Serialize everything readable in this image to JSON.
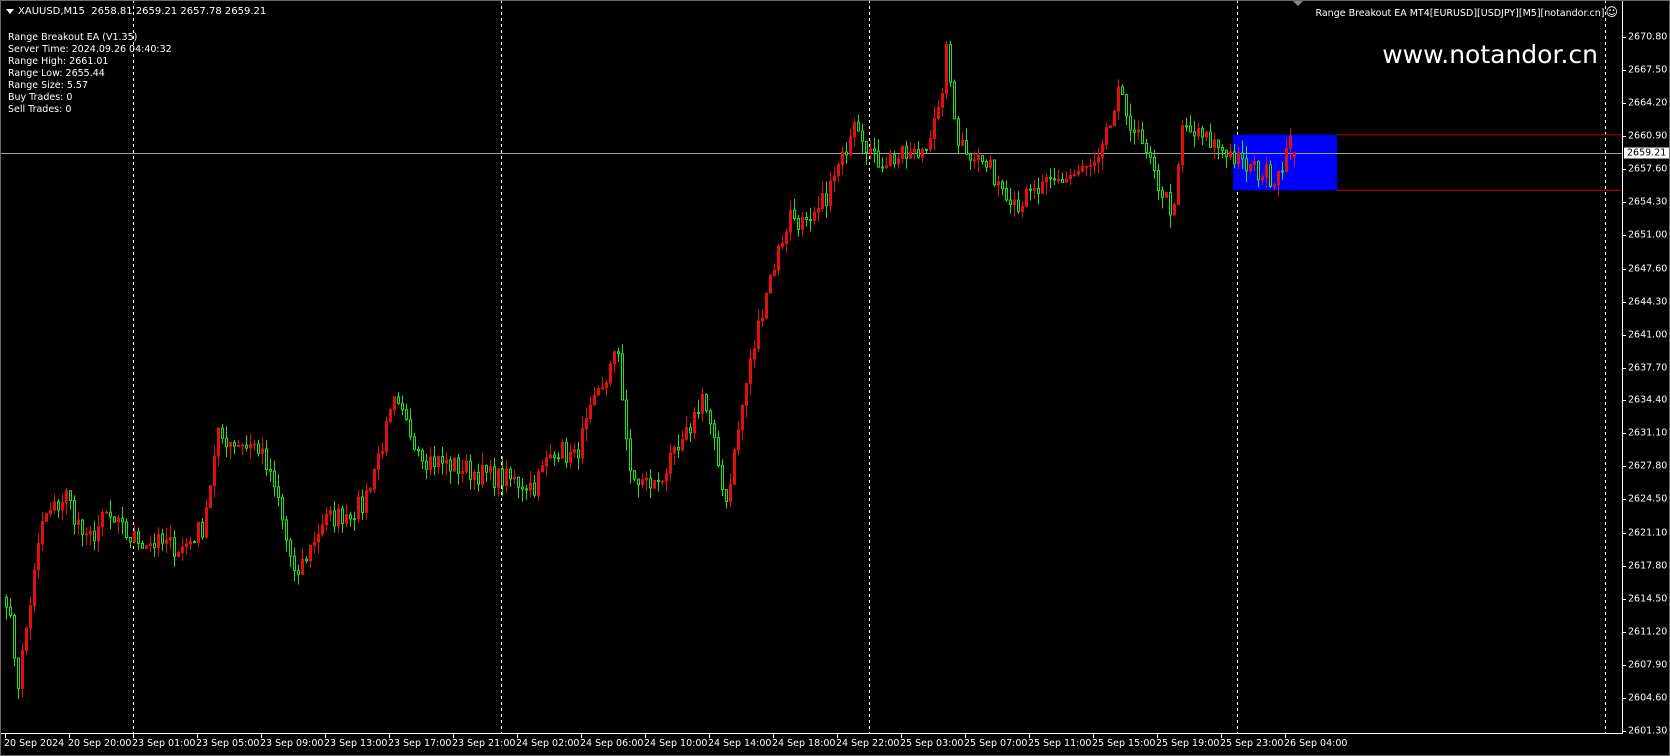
{
  "header": {
    "symbol": "XAUUSD,M15",
    "ohlc": "2658.81 2659.21 2657.78 2659.21"
  },
  "info_panel": {
    "lines": [
      "Range Breakout EA (V1.35)",
      "Server Time: 2024.09.26 04:40:32",
      "Range High: 2661.01",
      "Range Low: 2655.44",
      "Range Size: 5.57",
      "Buy Trades: 0",
      "Sell Trades: 0"
    ]
  },
  "ea_title": "Range Breakout EA MT4[EURUSD][USDJPY][M5][notandor.cn]",
  "watermark": "www.notandor.cn",
  "current_price": "2659.21",
  "colors": {
    "bull": "#e01010",
    "bear": "#20e020",
    "range_box": "#0000ff",
    "range_line": "#c00000",
    "price_line": "#a0a0a0"
  },
  "chart_data": {
    "type": "candlestick",
    "timeframe": "M15",
    "ylim": [
      2601.3,
      2670.8
    ],
    "range": {
      "high": 2661.01,
      "low": 2655.44,
      "start_bar": 307,
      "end_bar": 333
    },
    "last_bar": {
      "open": 2658.81,
      "high": 2659.21,
      "low": 2657.78,
      "close": 2659.21
    },
    "price_ticks": [
      "2670.80",
      "2667.50",
      "2664.20",
      "2660.90",
      "2657.60",
      "2654.30",
      "2651.00",
      "2647.60",
      "2644.30",
      "2641.00",
      "2637.70",
      "2634.40",
      "2631.10",
      "2627.80",
      "2624.50",
      "2621.10",
      "2617.80",
      "2614.50",
      "2611.20",
      "2607.90",
      "2604.60",
      "2601.30"
    ],
    "time_ticks": [
      "20 Sep 2024",
      "20 Sep 20:00",
      "23 Sep 01:00",
      "23 Sep 05:00",
      "23 Sep 09:00",
      "23 Sep 13:00",
      "23 Sep 17:00",
      "23 Sep 21:00",
      "24 Sep 02:00",
      "24 Sep 06:00",
      "24 Sep 10:00",
      "24 Sep 14:00",
      "24 Sep 18:00",
      "24 Sep 22:00",
      "25 Sep 03:00",
      "25 Sep 07:00",
      "25 Sep 11:00",
      "25 Sep 15:00",
      "25 Sep 19:00",
      "25 Sep 23:00",
      "26 Sep 04:00"
    ],
    "day_separator_bars": [
      32,
      124,
      216,
      308,
      400
    ],
    "close_path_bar_price": [
      [
        0,
        2614.8
      ],
      [
        3,
        2606.2
      ],
      [
        9,
        2622.2
      ],
      [
        15,
        2624.9
      ],
      [
        20,
        2620.1
      ],
      [
        25,
        2622.8
      ],
      [
        31,
        2620.6
      ],
      [
        44,
        2619.6
      ],
      [
        49,
        2621.7
      ],
      [
        53,
        2630.7
      ],
      [
        63,
        2629.7
      ],
      [
        68,
        2624.4
      ],
      [
        72,
        2616.4
      ],
      [
        79,
        2622.2
      ],
      [
        89,
        2623.8
      ],
      [
        97,
        2633.9
      ],
      [
        105,
        2628.6
      ],
      [
        119,
        2627.0
      ],
      [
        132,
        2625.9
      ],
      [
        137,
        2629.7
      ],
      [
        142,
        2628.6
      ],
      [
        148,
        2635.0
      ],
      [
        153,
        2639.3
      ],
      [
        156,
        2626.5
      ],
      [
        162,
        2625.9
      ],
      [
        169,
        2629.7
      ],
      [
        174,
        2635.0
      ],
      [
        180,
        2624.4
      ],
      [
        185,
        2636.1
      ],
      [
        190,
        2645.6
      ],
      [
        196,
        2653.1
      ],
      [
        201,
        2651.5
      ],
      [
        209,
        2658.4
      ],
      [
        212,
        2663.2
      ],
      [
        217,
        2658.4
      ],
      [
        228,
        2659.0
      ],
      [
        233,
        2662.7
      ],
      [
        235,
        2669.1
      ],
      [
        238,
        2660.6
      ],
      [
        246,
        2657.4
      ],
      [
        253,
        2654.2
      ],
      [
        265,
        2656.8
      ],
      [
        273,
        2657.9
      ],
      [
        278,
        2664.8
      ],
      [
        282,
        2661.6
      ],
      [
        287,
        2656.8
      ],
      [
        292,
        2653.1
      ],
      [
        294,
        2661.6
      ],
      [
        305,
        2659.5
      ],
      [
        309,
        2657.9
      ],
      [
        317,
        2656.8
      ],
      [
        321,
        2660.0
      ],
      [
        322,
        2659.21
      ]
    ]
  }
}
